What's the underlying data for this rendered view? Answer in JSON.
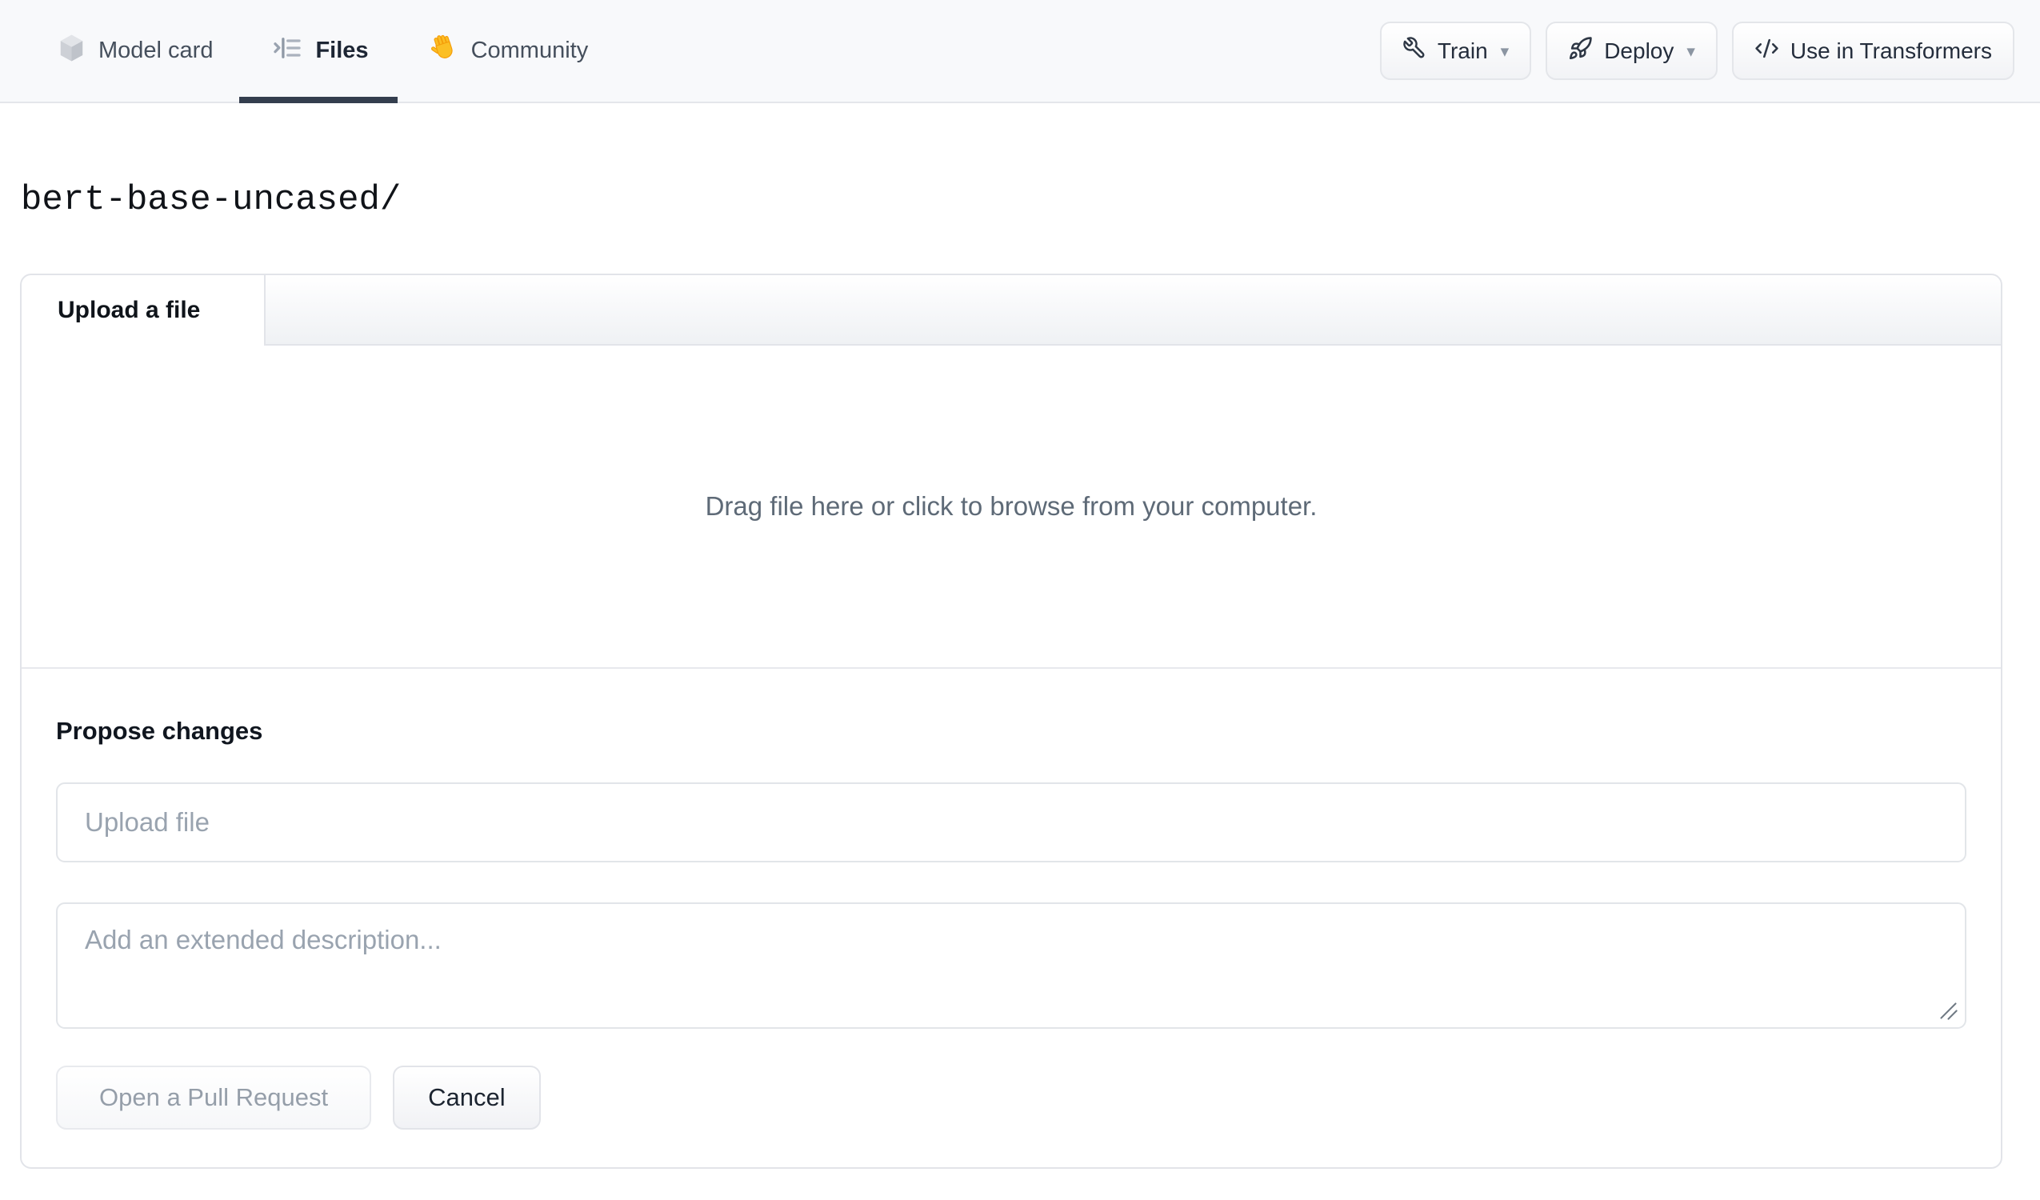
{
  "header": {
    "caret_glyph": "▾",
    "tabs": [
      {
        "label": "Model card"
      },
      {
        "label": "Files"
      },
      {
        "label": "Community"
      }
    ],
    "actions": [
      {
        "label": "Train"
      },
      {
        "label": "Deploy"
      },
      {
        "label": "Use in Transformers"
      }
    ]
  },
  "path": {
    "current": "bert-base-uncased/"
  },
  "upload_panel": {
    "tab_label": "Upload a file",
    "dropzone_hint": "Drag file here or click to browse from your computer.",
    "propose_heading": "Propose changes",
    "filename_placeholder": "Upload file",
    "description_placeholder": "Add an extended description...",
    "open_pr_label": "Open a Pull Request",
    "cancel_label": "Cancel"
  },
  "colors": {
    "header_bg": "#f8f9fb",
    "active_tab_underline": "#343e4e",
    "panel_border": "#e2e4e9",
    "muted_text": "#5e6a77",
    "placeholder_text": "#99a3af",
    "hand_emoji": "#fbbf24"
  }
}
